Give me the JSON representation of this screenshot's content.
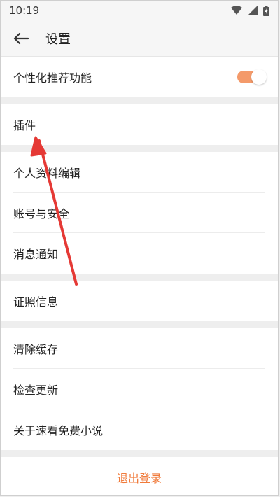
{
  "statusbar": {
    "time": "10:19"
  },
  "appbar": {
    "title": "设置"
  },
  "sections": [
    {
      "items": [
        {
          "label": "个性化推荐功能",
          "toggle": true
        }
      ]
    },
    {
      "items": [
        {
          "label": "插件"
        }
      ]
    },
    {
      "items": [
        {
          "label": "个人资料编辑"
        },
        {
          "label": "账号与安全"
        },
        {
          "label": "消息通知"
        }
      ]
    },
    {
      "items": [
        {
          "label": "证照信息"
        }
      ]
    },
    {
      "items": [
        {
          "label": "清除缓存"
        },
        {
          "label": "检查更新"
        },
        {
          "label": "关于速看免费小说"
        }
      ]
    }
  ],
  "logout_label": "退出登录",
  "colors": {
    "accent": "#f07b3c",
    "arrow": "#e53935"
  }
}
